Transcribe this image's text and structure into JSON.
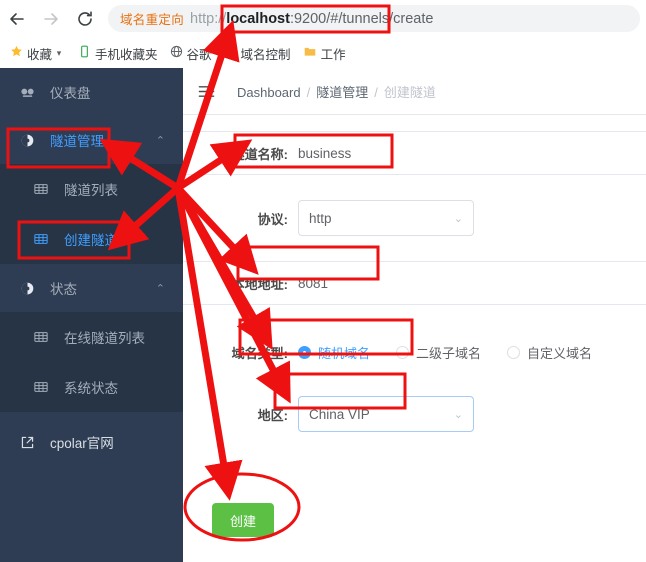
{
  "browser": {
    "nav": {
      "back": "back-arrow",
      "forward": "forward-arrow",
      "reload": "reload",
      "home": "home"
    },
    "omnibox": {
      "redirect_badge": "域名重定向",
      "url_scheme": "http://",
      "url_host": "localhost",
      "url_rest": ":9200/#/tunnels/create",
      "full_url": "http://localhost:9200/#/tunnels/create"
    },
    "bookmarks": [
      {
        "icon": "star-icon",
        "label": "收藏",
        "caret": "▾"
      },
      {
        "icon": "phone-icon",
        "label": "手机收藏夹",
        "caret": ""
      },
      {
        "icon": "globe-icon",
        "label": "谷歌",
        "caret": ""
      },
      {
        "icon": "circle-icon",
        "label": "域名控制",
        "caret": ""
      },
      {
        "icon": "folder-icon",
        "label": "工作",
        "caret": ""
      }
    ]
  },
  "sidebar": {
    "items": [
      {
        "icon": "dashboard-icon",
        "label": "仪表盘",
        "caret": "",
        "level": "top",
        "state": "normal"
      },
      {
        "icon": "tunnel-icon",
        "label": "隧道管理",
        "caret": "⌃",
        "level": "top",
        "state": "highlight"
      },
      {
        "icon": "grid-icon",
        "label": "隧道列表",
        "caret": "",
        "level": "sub",
        "state": "normal"
      },
      {
        "icon": "grid-icon",
        "label": "创建隧道",
        "caret": "",
        "level": "sub",
        "state": "active"
      },
      {
        "icon": "status-icon",
        "label": "状态",
        "caret": "⌃",
        "level": "top",
        "state": "normal"
      },
      {
        "icon": "grid-icon",
        "label": "在线隧道列表",
        "caret": "",
        "level": "sub",
        "state": "normal"
      },
      {
        "icon": "grid-icon",
        "label": "系统状态",
        "caret": "",
        "level": "sub",
        "state": "normal"
      },
      {
        "icon": "external-link-icon",
        "label": "cpolar官网",
        "caret": "",
        "level": "top",
        "state": "normal"
      }
    ]
  },
  "topbar": {
    "collapse_icon": "collapse-menu-icon",
    "breadcrumb": {
      "root": "Dashboard",
      "parent": "隧道管理",
      "current": "创建隧道",
      "separator": "/"
    }
  },
  "form": {
    "tunnel_name": {
      "label": "隧道名称:",
      "value": "business",
      "placeholder": ""
    },
    "protocol": {
      "label": "协议:",
      "value": "http",
      "arrow": "⌄"
    },
    "local_address": {
      "label": "本地地址:",
      "value": "8081",
      "placeholder": ""
    },
    "domain_type": {
      "label": "域名类型:",
      "options": [
        {
          "label": "随机域名",
          "selected": true
        },
        {
          "label": "二级子域名",
          "selected": false
        },
        {
          "label": "自定义域名",
          "selected": false
        }
      ]
    },
    "region": {
      "label": "地区:",
      "value": "China VIP",
      "arrow": "⌄"
    },
    "submit": {
      "label": "创建"
    }
  },
  "colors": {
    "sidebar_bg": "#2f3d54",
    "submenu_bg": "#263445",
    "accent_blue": "#409eff",
    "button_green": "#5cc045",
    "annotation_red": "#ee1111",
    "redirect_orange": "#e8700f"
  }
}
